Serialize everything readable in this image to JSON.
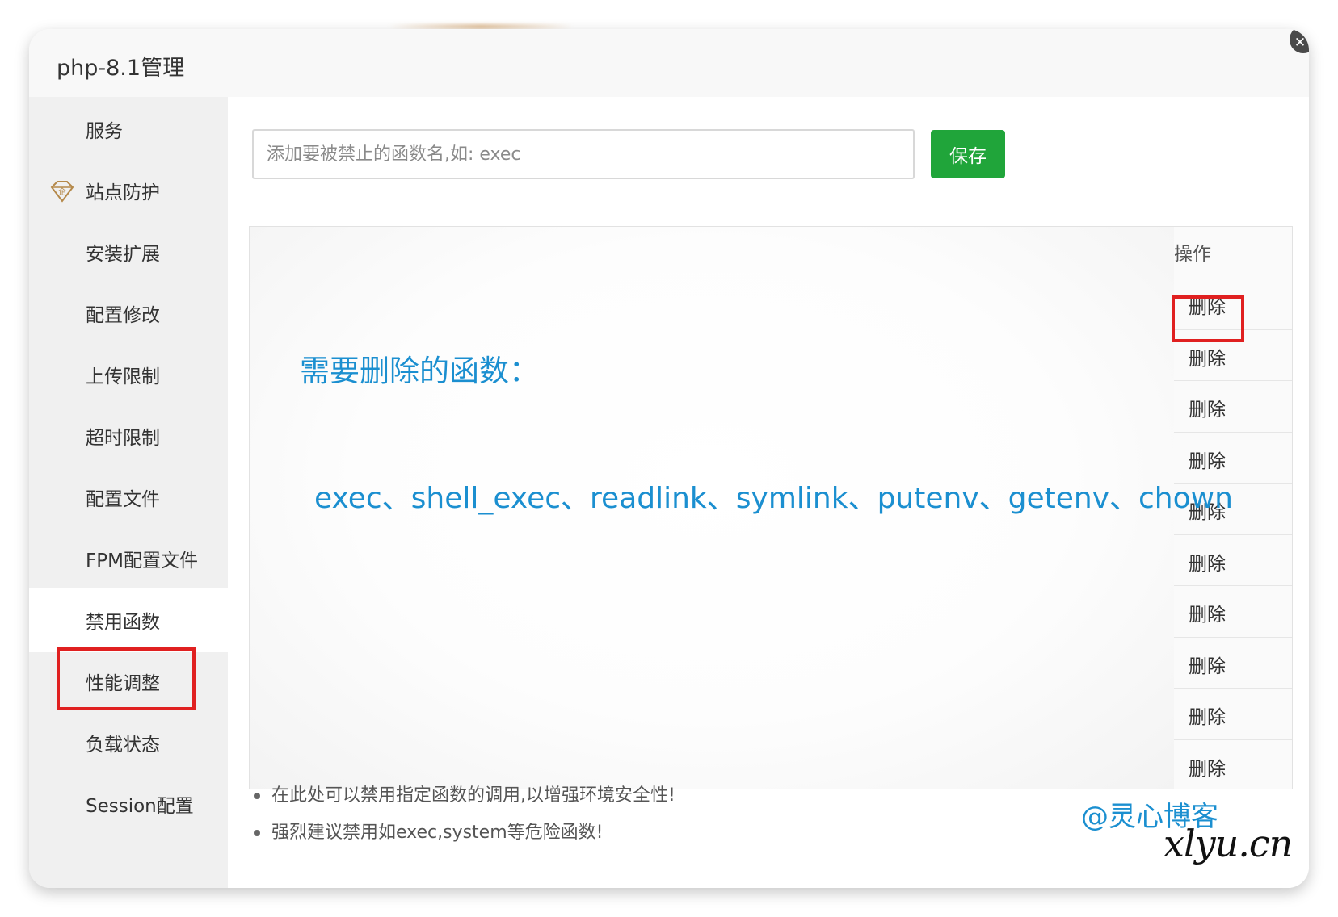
{
  "window": {
    "title": "php-8.1管理",
    "close_icon": "✕"
  },
  "sidebar": {
    "items": [
      {
        "label": "服务"
      },
      {
        "label": "站点防护",
        "icon": "enterprise-diamond-icon",
        "icon_text": "企"
      },
      {
        "label": "安装扩展"
      },
      {
        "label": "配置修改"
      },
      {
        "label": "上传限制"
      },
      {
        "label": "超时限制"
      },
      {
        "label": "配置文件"
      },
      {
        "label": "FPM配置文件"
      },
      {
        "label": "禁用函数",
        "active": true
      },
      {
        "label": "性能调整"
      },
      {
        "label": "负载状态"
      },
      {
        "label": "Session配置"
      }
    ]
  },
  "form": {
    "input_placeholder": "添加要被禁止的函数名,如: exec",
    "input_value": "",
    "save_label": "保存"
  },
  "table": {
    "op_header": "操作",
    "rows": [
      {
        "action": "删除"
      },
      {
        "action": "删除"
      },
      {
        "action": "删除"
      },
      {
        "action": "删除"
      },
      {
        "action": "删除"
      },
      {
        "action": "删除"
      },
      {
        "action": "删除"
      },
      {
        "action": "删除"
      },
      {
        "action": "删除"
      },
      {
        "action": "删除"
      }
    ]
  },
  "overlay": {
    "title": "需要删除的函数：",
    "functions": "exec、shell_exec、readlink、symlink、putenv、getenv、chown"
  },
  "tips": [
    "在此处可以禁用指定函数的调用,以增强环境安全性!",
    "强烈建议禁用如exec,system等危险函数!"
  ],
  "watermark": {
    "line1": "@灵心博客",
    "line2": "xlyu.cn"
  },
  "colors": {
    "accent_green": "#20a53a",
    "highlight_red": "#e02020",
    "overlay_blue": "#1b8fd0",
    "sidebar_bg": "#f0f0f0"
  }
}
